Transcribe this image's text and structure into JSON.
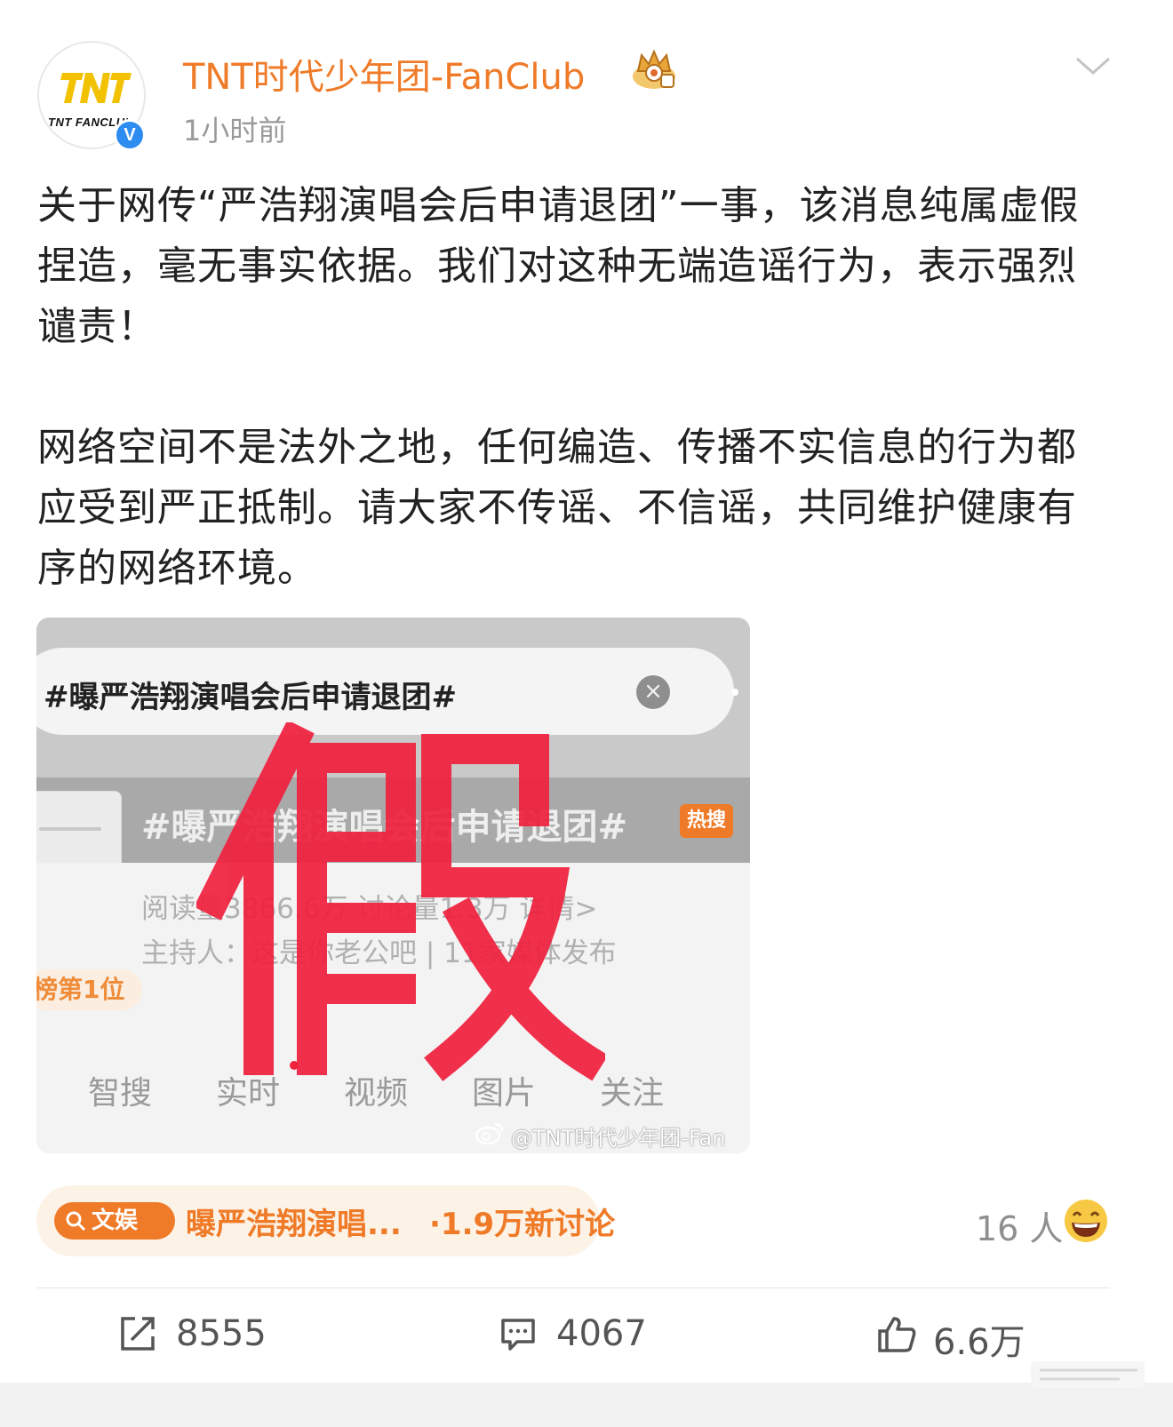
{
  "post": {
    "author": "TNT时代少年团-FanClub",
    "avatar_text": "TNT FANCLUB",
    "verified_mark": "V",
    "time": "1小时前",
    "paragraph1": "关于网传“严浩翔演唱会后申请退团”一事，该消息纯属虚假捏造，毫无事实依据。我们对这种无端造谣行为，表示强烈谴责！",
    "paragraph2": "网络空间不是法外之地，任何编造、传播不实信息的行为都应受到严正抵制。请大家不传谣、不信谣，共同维护健康有序的网络环境。"
  },
  "image": {
    "search_text": "#曝严浩翔演唱会后申请退团#",
    "clear_glyph": "×",
    "topic_text": "#曝严浩翔演唱会后申请退团#",
    "hot_badge": "热搜",
    "stats": "阅读量3866.6万  讨论量1.3万    详情>",
    "host": "主持人：这是你老公吧 | 11家媒体发布",
    "rank": "榜第1位",
    "tabs": [
      "智搜",
      "实时",
      "视频",
      "图片",
      "关注"
    ],
    "watermark": "@TNT时代少年团-Fan",
    "stamp_color": "#f0223f"
  },
  "topic": {
    "tag": "文娱",
    "title": "曝严浩翔演唱...",
    "count": "·1.9万新讨论"
  },
  "reactions": {
    "count": "16 人"
  },
  "actions": {
    "repost": "8555",
    "comment": "4067",
    "like": "6.6万"
  },
  "colors": {
    "accent": "#ef7a27",
    "verified": "#2d8cf0",
    "text": "#222222",
    "muted": "#9a9a9a"
  },
  "icons": [
    "crown-icon",
    "chevron-down-icon",
    "verified-icon",
    "search-icon",
    "laugh-emoji-icon",
    "repost-icon",
    "comment-icon",
    "like-icon"
  ]
}
